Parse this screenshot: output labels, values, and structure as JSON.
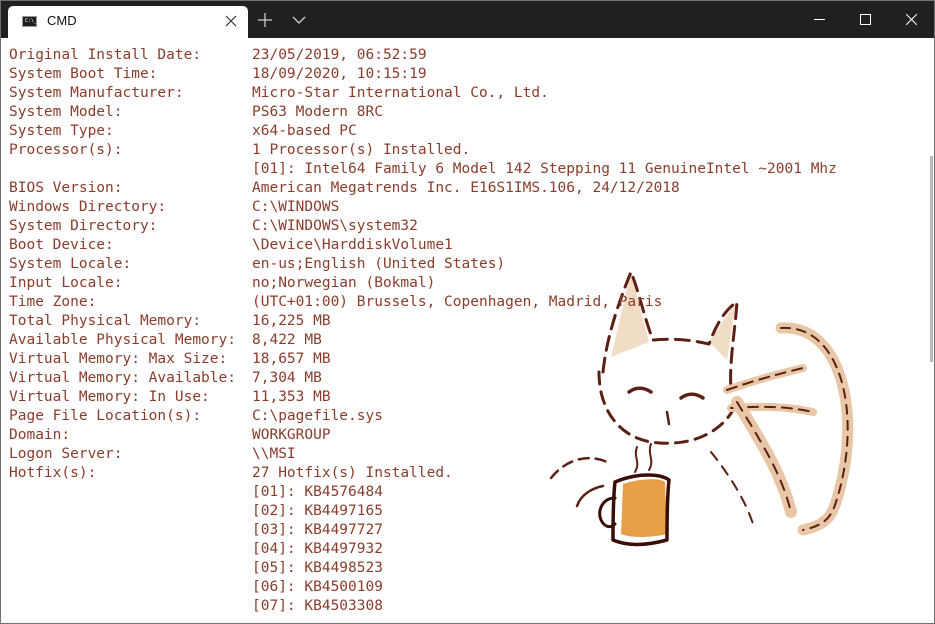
{
  "tab": {
    "title": "CMD",
    "icon": "console-app-icon",
    "icon_glyph": "C:\\_"
  },
  "titlebar_actions": [
    "close-tab-icon",
    "plus-icon",
    "chevron-down-icon",
    "minimize-icon",
    "maximize-icon",
    "window-close-icon"
  ],
  "colors": {
    "text": "#8a3d2c",
    "titlebar": "#202020",
    "background": "#ffffff"
  },
  "systeminfo": [
    {
      "key": "Original Install Date:",
      "value": "23/05/2019, 06:52:59"
    },
    {
      "key": "System Boot Time:",
      "value": "18/09/2020, 10:15:19"
    },
    {
      "key": "System Manufacturer:",
      "value": "Micro-Star International Co., Ltd."
    },
    {
      "key": "System Model:",
      "value": "PS63 Modern 8RC"
    },
    {
      "key": "System Type:",
      "value": "x64-based PC"
    },
    {
      "key": "Processor(s):",
      "value": "1 Processor(s) Installed."
    },
    {
      "key": "",
      "value": "[01]: Intel64 Family 6 Model 142 Stepping 11 GenuineIntel ~2001 Mhz"
    },
    {
      "key": "BIOS Version:",
      "value": "American Megatrends Inc. E16S1IMS.106, 24/12/2018"
    },
    {
      "key": "Windows Directory:",
      "value": "C:\\WINDOWS"
    },
    {
      "key": "System Directory:",
      "value": "C:\\WINDOWS\\system32"
    },
    {
      "key": "Boot Device:",
      "value": "\\Device\\HarddiskVolume1"
    },
    {
      "key": "System Locale:",
      "value": "en-us;English (United States)"
    },
    {
      "key": "Input Locale:",
      "value": "no;Norwegian (Bokmal)"
    },
    {
      "key": "Time Zone:",
      "value": "(UTC+01:00) Brussels, Copenhagen, Madrid, Paris"
    },
    {
      "key": "Total Physical Memory:",
      "value": "16,225 MB"
    },
    {
      "key": "Available Physical Memory:",
      "value": "8,422 MB"
    },
    {
      "key": "Virtual Memory: Max Size:",
      "value": "18,657 MB"
    },
    {
      "key": "Virtual Memory: Available:",
      "value": "7,304 MB"
    },
    {
      "key": "Virtual Memory: In Use:",
      "value": "11,353 MB"
    },
    {
      "key": "Page File Location(s):",
      "value": "C:\\pagefile.sys"
    },
    {
      "key": "Domain:",
      "value": "WORKGROUP"
    },
    {
      "key": "Logon Server:",
      "value": "\\\\MSI"
    },
    {
      "key": "Hotfix(s):",
      "value": "27 Hotfix(s) Installed."
    },
    {
      "key": "",
      "value": "[01]: KB4576484"
    },
    {
      "key": "",
      "value": "[02]: KB4497165"
    },
    {
      "key": "",
      "value": "[03]: KB4497727"
    },
    {
      "key": "",
      "value": "[04]: KB4497932"
    },
    {
      "key": "",
      "value": "[05]: KB4498523"
    },
    {
      "key": "",
      "value": "[06]: KB4500109"
    },
    {
      "key": "",
      "value": "[07]: KB4503308"
    }
  ],
  "background_image": "cat-drinking-coffee-drawing"
}
